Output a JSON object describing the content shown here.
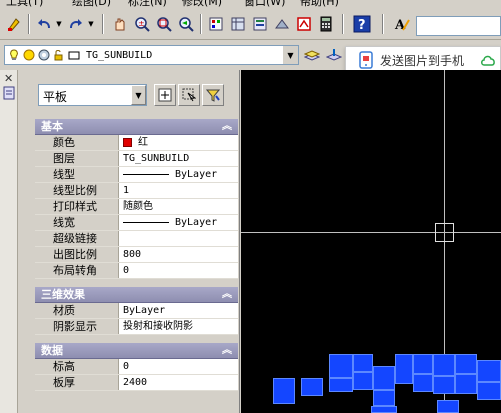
{
  "menu": {
    "items": [
      "工具(T)",
      "绘图(D)",
      "标注(N)",
      "修改(M)",
      "窗口(W)",
      "帮助(H)"
    ]
  },
  "toolbar": {
    "icons": [
      "match-properties-icon",
      "undo-icon",
      "redo-icon",
      "pan-icon",
      "zoom-realtime-icon",
      "zoom-window-icon",
      "zoom-previous-icon",
      "properties-icon",
      "design-center-icon",
      "tool-palettes-icon",
      "sheet-set-icon",
      "markup-icon",
      "calculator-icon",
      "help-icon",
      "text-style-icon"
    ],
    "search_value": ""
  },
  "layer_bar": {
    "current_layer": "TG_SUNBUILD"
  },
  "popup": {
    "label": "发送图片到手机"
  },
  "panel": {
    "object_type": "平板",
    "sections": {
      "basic": {
        "title": "基本",
        "rows": [
          {
            "key": "颜色",
            "value": "红"
          },
          {
            "key": "图层",
            "value": "TG_SUNBUILD"
          },
          {
            "key": "线型",
            "value": "ByLayer"
          },
          {
            "key": "线型比例",
            "value": "1"
          },
          {
            "key": "打印样式",
            "value": "随颜色"
          },
          {
            "key": "线宽",
            "value": "ByLayer"
          },
          {
            "key": "超级链接",
            "value": ""
          },
          {
            "key": "出图比例",
            "value": "800"
          },
          {
            "key": "布局转角",
            "value": "0"
          }
        ]
      },
      "three_d": {
        "title": "三维效果",
        "rows": [
          {
            "key": "材质",
            "value": "ByLayer"
          },
          {
            "key": "阴影显示",
            "value": "投射和接收阴影"
          }
        ]
      },
      "data": {
        "title": "数据",
        "rows": [
          {
            "key": "标高",
            "value": "0"
          },
          {
            "key": "板厚",
            "value": "2400"
          }
        ]
      }
    }
  },
  "colors": {
    "canvas_bg": "#000000",
    "block_fill": "#1446ff",
    "section_header": "#9a9abc",
    "color_swatch": "#e00000"
  }
}
